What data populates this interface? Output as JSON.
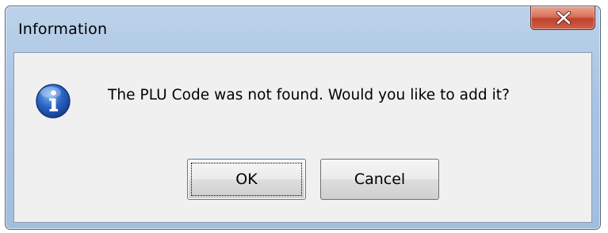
{
  "dialog": {
    "title": "Information",
    "message": "The PLU Code was not found. Would you like to add it?",
    "icon": "information-icon",
    "buttons": {
      "ok_label": "OK",
      "cancel_label": "Cancel"
    },
    "focused_button": "OK"
  },
  "titlebar": {
    "close_icon": "close-icon"
  },
  "colors": {
    "close_button": "#c9533d",
    "info_icon": "#1f56b5",
    "client_background": "#f0f0f0"
  }
}
